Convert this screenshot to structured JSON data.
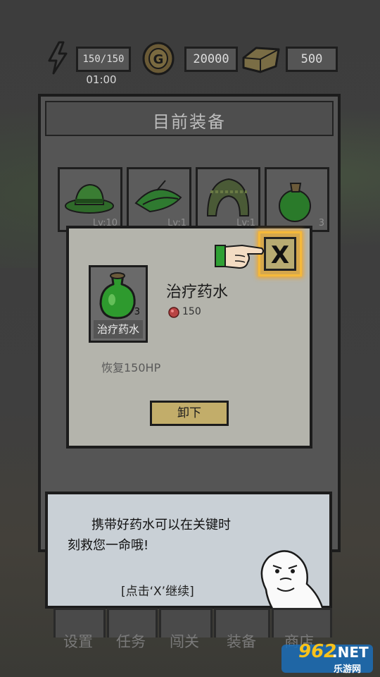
{
  "top_bar": {
    "energy": "150/150",
    "timer": "01:00",
    "gold": "20000",
    "gems": "500"
  },
  "panel": {
    "title": "目前装备",
    "slots": [
      {
        "icon": "green-hat-icon",
        "level": "Lv:10"
      },
      {
        "icon": "green-feather-hat-icon",
        "level": "Lv:1"
      },
      {
        "icon": "knit-helmet-icon",
        "level": "Lv:1"
      },
      {
        "icon": "potion-icon",
        "level": "3"
      }
    ]
  },
  "dialog": {
    "item_label": "治疗药水",
    "item_count": "3",
    "item_name": "治疗药水",
    "cost": "150",
    "description": "恢复150HP",
    "unequip_label": "卸下",
    "close_label": "X"
  },
  "tutorial": {
    "line1": "携带好药水可以在关键时",
    "line2": "刻救您一命哦!",
    "hint": "[点击‘X’继续]"
  },
  "nav": {
    "items": [
      "设置",
      "任务",
      "闯关",
      "装备",
      "商店"
    ]
  },
  "watermark": {
    "num": "962",
    "net": ".NET",
    "text": "乐游网"
  },
  "colors": {
    "highlight": "#f5b93a",
    "potion": "#2e9a2e"
  }
}
